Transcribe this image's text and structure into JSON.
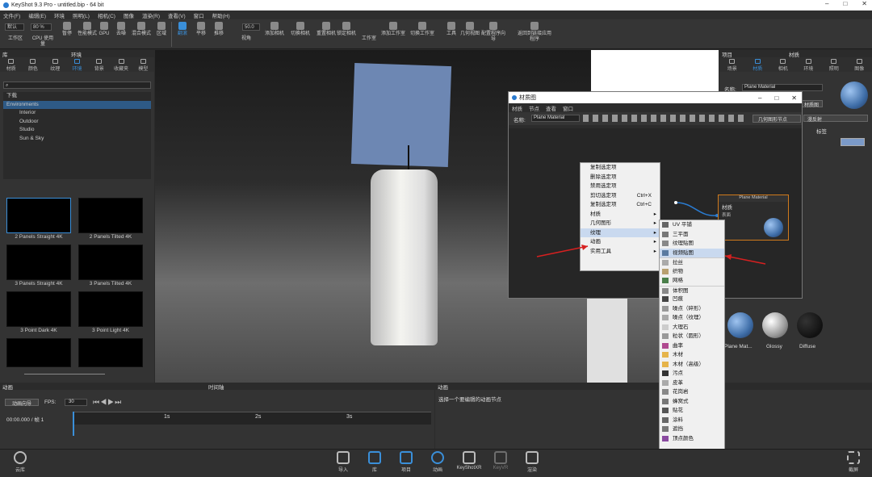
{
  "window": {
    "title": "KeyShot 9.3 Pro - untitled.bip - 64 bit"
  },
  "menubar": [
    "文件(F)",
    "编辑(E)",
    "环境",
    "照明(L)",
    "相机(C)",
    "图像",
    "渲染(R)",
    "查看(V)",
    "窗口",
    "帮助(H)"
  ],
  "toolbar": {
    "workspace_value": "默认",
    "cpu_value": "80 %",
    "zoom_value": "50.0",
    "items": [
      "工作区",
      "CPU 使用量",
      "暂停",
      "性能模式",
      "GPU",
      "去噪",
      "混合模式",
      "区域",
      "翻滚",
      "平移",
      "推移",
      "视角",
      "添加相机",
      "切换相机",
      "重置相机",
      "锁定相机",
      "工作室",
      "添加工作室",
      "切换工作室",
      "工具",
      "几何视图",
      "配置程序向导",
      "返回到链接应用程序"
    ]
  },
  "library": {
    "header": "库",
    "env_header": "环境",
    "tabs": [
      "材质",
      "颜色",
      "纹理",
      "环境",
      "背景",
      "收藏夹",
      "模型"
    ],
    "tree": [
      "下载",
      "Environments",
      "Interior",
      "Outdoor",
      "Studio",
      "Sun & Sky"
    ],
    "thumbnails": [
      "2 Panels Straight 4K",
      "2 Panels Tilted 4K",
      "3 Panels Straight 4K",
      "3 Panels Tilted 4K",
      "3 Point Dark 4K",
      "3 Point Light 4K"
    ]
  },
  "project": {
    "header": "项目",
    "mat_header": "材质",
    "tabs": [
      "场景",
      "材质",
      "相机",
      "环境",
      "照明",
      "图像"
    ],
    "name_label": "名称:",
    "name_value": "Plane Material",
    "btn1": "材质图",
    "btn2": "漫反射",
    "label_tag": "标签",
    "materials": [
      "Plane Mat...",
      "Glossy",
      "Diffuse"
    ]
  },
  "material_graph": {
    "title": "材质图",
    "menu": [
      "材质",
      "节点",
      "查看",
      "窗口"
    ],
    "name_label": "名称:",
    "name_value": "Plane Material",
    "node_btn": "几何图形节点",
    "node_title": "Plane Material",
    "node_label": "材质",
    "node_port": "表面"
  },
  "context_menu": [
    {
      "label": "复制选定项",
      "shortcut": ""
    },
    {
      "label": "删除选定项",
      "shortcut": ""
    },
    {
      "label": "禁用选定项",
      "shortcut": ""
    },
    {
      "label": "剪切选定项",
      "shortcut": "Ctrl+X"
    },
    {
      "label": "复制选定项",
      "shortcut": "Ctrl+C"
    },
    {
      "label": "材质",
      "shortcut": ""
    },
    {
      "label": "几何图形",
      "shortcut": ""
    },
    {
      "label": "纹理",
      "shortcut": ""
    },
    {
      "label": "动画",
      "shortcut": ""
    },
    {
      "label": "实用工具",
      "shortcut": ""
    }
  ],
  "texture_submenu": [
    "UV 平铺",
    "三平面",
    "纹理贴图",
    "视频贴图",
    "拉丝",
    "织物",
    "网格",
    "体积图",
    "凹痕",
    "噪点（碎形）",
    "噪点（纹理）",
    "大理石",
    "粒状（圆形）",
    "曲率",
    "木材",
    "木材（高级）",
    "污点",
    "皮革",
    "花岗岩",
    "蜂窝式",
    "贴花",
    "涂料",
    "遮挡",
    "顶点颜色"
  ],
  "timeline": {
    "header": "时间轴",
    "anim_header": "动画",
    "wizard": "动画向导",
    "fps_label": "FPS:",
    "fps_value": "30",
    "time": "00:00.000 / 帧 1",
    "ticks": [
      "1s",
      "2s",
      "3s"
    ]
  },
  "anim_panel": {
    "header": "动画",
    "hint": "选择一个要编辑的动画节点"
  },
  "bottom": {
    "cloud": "云库",
    "items": [
      "导入",
      "库",
      "项目",
      "动画",
      "KeyShotXR",
      "KeyVR",
      "渲染"
    ],
    "screenshot": "截屏"
  }
}
